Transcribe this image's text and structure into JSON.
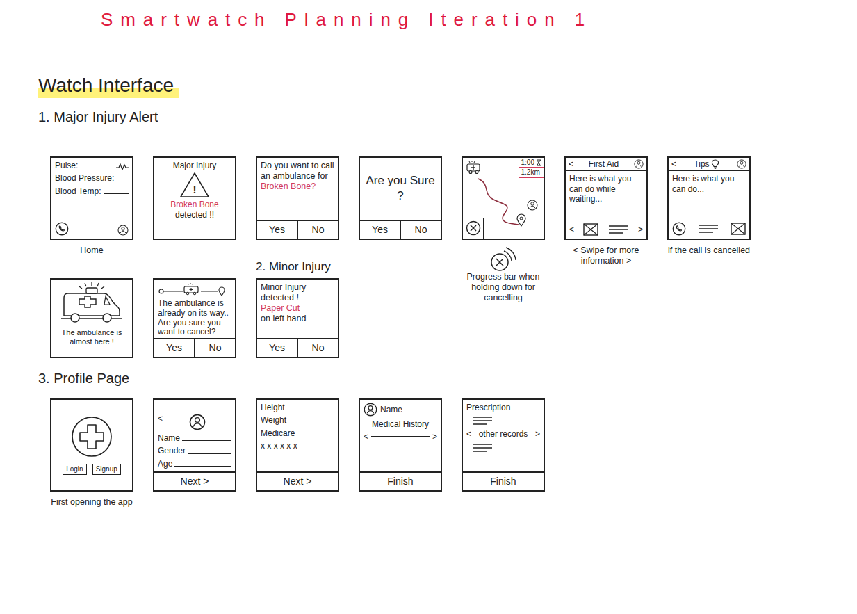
{
  "title": "Smartwatch Planning Iteration 1",
  "heading": "Watch Interface",
  "sections": [
    {
      "label": "1. Major Injury Alert",
      "screens": [
        {
          "kind": "vitals",
          "fields": [
            "Pulse:",
            "Blood Pressure:",
            "Blood Temp:"
          ],
          "note": "Home"
        },
        {
          "kind": "alert",
          "title": "Major Injury",
          "symbol": "!",
          "injury": "Broken Bone",
          "text": "detected !!"
        },
        {
          "kind": "question",
          "parts": [
            {
              "text": "Do you want to call an ambulance for",
              "color": "#222222"
            },
            {
              "text": "Broken Bone?",
              "color": "#d23a5a"
            }
          ],
          "buttons": [
            "Yes",
            "No"
          ]
        },
        {
          "kind": "confirm",
          "text": "Are you Sure ?",
          "buttons": [
            "Yes",
            "No"
          ]
        },
        {
          "kind": "map",
          "timer": "1:00",
          "distance": "1.2km",
          "note": "Progress bar when holding down for cancelling"
        },
        {
          "kind": "info",
          "back": "<",
          "title": "First Aid",
          "text": "Here is what you can do while waiting...",
          "prev": "<",
          "next": ">",
          "note": "< Swipe for more information >"
        },
        {
          "kind": "tips",
          "back": "<",
          "title": "Tips",
          "text": "Here is what you can do...",
          "note": "if the call is cancelled"
        },
        {
          "kind": "arrival",
          "text": "The ambulance is almost here !"
        },
        {
          "kind": "cancel",
          "text": "The ambulance is already on its way.. Are you sure you want to cancel?",
          "buttons": [
            "Yes",
            "No"
          ]
        }
      ]
    },
    {
      "label": "2. Minor Injury",
      "screens": [
        {
          "kind": "question",
          "parts": [
            {
              "text": "Minor Injury detected !",
              "color": "#222222"
            },
            {
              "text": "Paper Cut",
              "color": "#d23a5a"
            },
            {
              "text": "on left hand",
              "color": "#222222"
            }
          ],
          "buttons": [
            "Yes",
            "No"
          ]
        }
      ]
    },
    {
      "label": "3. Profile Page",
      "screens": [
        {
          "kind": "welcome",
          "buttons": [
            "Login",
            "Signup"
          ],
          "note": "First opening the app"
        },
        {
          "kind": "form",
          "back": "<",
          "fields": [
            "Name",
            "Gender",
            "Age"
          ],
          "footer": "Next >"
        },
        {
          "kind": "form",
          "fields": [
            "Height",
            "Weight"
          ],
          "lines": [
            "Medicare",
            "x x x  x x x"
          ],
          "footer": "Next >"
        },
        {
          "kind": "record",
          "name": "Name",
          "title": "Medical History",
          "prev": "<",
          "next": ">",
          "footer": "Finish"
        },
        {
          "kind": "records",
          "title": "Prescription",
          "middle": "other records",
          "prev": "<",
          "next": ">",
          "footer": "Finish"
        }
      ]
    }
  ]
}
